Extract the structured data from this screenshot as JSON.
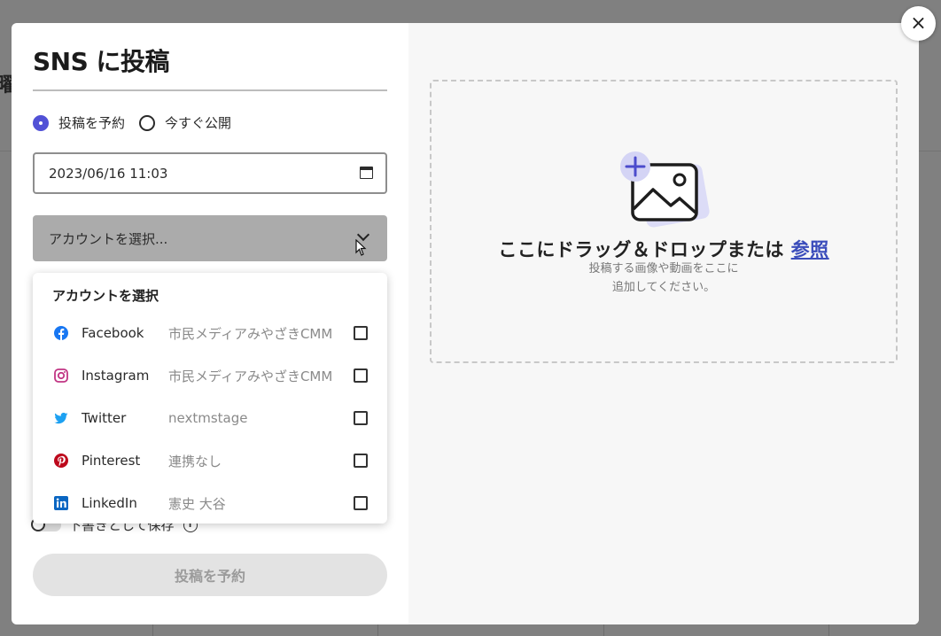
{
  "background": {
    "partial_glyph": "曜"
  },
  "modal": {
    "title": "SNS に投稿",
    "radio": {
      "schedule_label": "投稿を予約",
      "now_label": "今すぐ公開",
      "selected": "schedule"
    },
    "datetime_value": "2023/06/16  11:03",
    "account_select": {
      "placeholder": "アカウントを選択..."
    },
    "dropdown": {
      "title": "アカウントを選択",
      "items": [
        {
          "name": "Facebook",
          "account": "市民メディアみやざきCMM",
          "icon": "facebook-icon",
          "color": "#1877f2",
          "checked": false
        },
        {
          "name": "Instagram",
          "account": "市民メディアみやざきCMM",
          "icon": "instagram-icon",
          "color": "#c13584",
          "checked": false
        },
        {
          "name": "Twitter",
          "account": "nextmstage",
          "icon": "twitter-icon",
          "color": "#1da1f2",
          "checked": false
        },
        {
          "name": "Pinterest",
          "account": "連携なし",
          "icon": "pinterest-icon",
          "color": "#bd081c",
          "checked": false
        },
        {
          "name": "LinkedIn",
          "account": "憲史 大谷",
          "icon": "linkedin-icon",
          "color": "#0a66c2",
          "checked": false
        }
      ]
    },
    "draft_label": "下書きとして保存",
    "submit_label": "投稿を予約",
    "dropzone": {
      "main_text": "ここにドラッグ＆ドロップまたは",
      "link_text": "参照",
      "sub_line1": "投稿する画像や動画をここに",
      "sub_line2": "追加してください。"
    },
    "close_symbol": "×"
  }
}
